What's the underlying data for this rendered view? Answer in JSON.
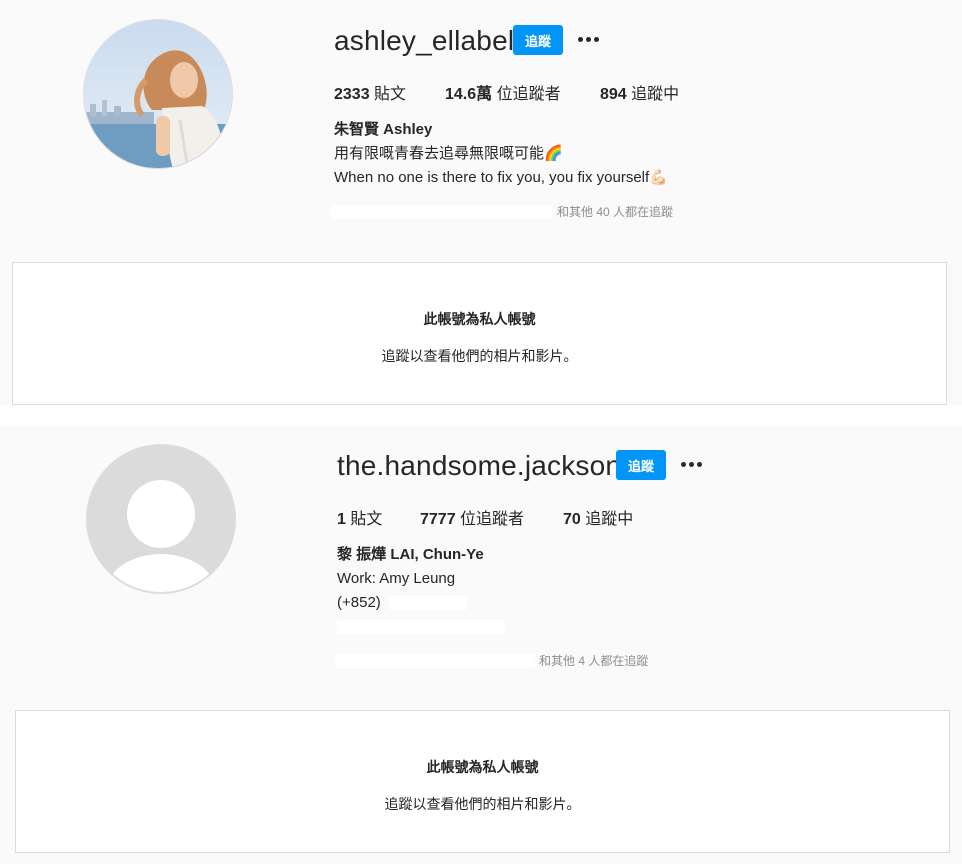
{
  "profiles": [
    {
      "username": "ashley_ellabel",
      "follow_label": "追蹤",
      "more_label": "•••",
      "stats": {
        "posts_num": "2333",
        "posts_label": " 貼文",
        "followers_num": "14.6萬",
        "followers_label": " 位追蹤者",
        "following_num": "894",
        "following_label": " 追蹤中"
      },
      "bio": {
        "full_name": "朱智賢 Ashley",
        "line1": "用有限嘅青春去追尋無限嘅可能🌈",
        "line2": "When no one is there to fix you, you fix yourself💪🏻"
      },
      "followed_by": "和其他 40 人都在追蹤",
      "private": {
        "title": "此帳號為私人帳號",
        "subtitle": "追蹤以查看他們的相片和影片。"
      }
    },
    {
      "username": "the.handsome.jackson",
      "follow_label": "追蹤",
      "more_label": "•••",
      "stats": {
        "posts_num": "1",
        "posts_label": " 貼文",
        "followers_num": "7777",
        "followers_label": " 位追蹤者",
        "following_num": "70",
        "following_label": " 追蹤中"
      },
      "bio": {
        "full_name": "黎 振燁 LAI, Chun-Ye",
        "line1": "Work: Amy Leung",
        "line2": "(+852)"
      },
      "followed_by": "和其他 4 人都在追蹤",
      "private": {
        "title": "此帳號為私人帳號",
        "subtitle": "追蹤以查看他們的相片和影片。"
      }
    }
  ],
  "colors": {
    "background": "#fafafa",
    "follow_button": "#0095f6",
    "text": "#262626",
    "muted": "#8e8e8e",
    "border": "#dbdbdb"
  },
  "icons": {
    "more": "more-options-icon",
    "default_avatar": "default-avatar-icon"
  }
}
